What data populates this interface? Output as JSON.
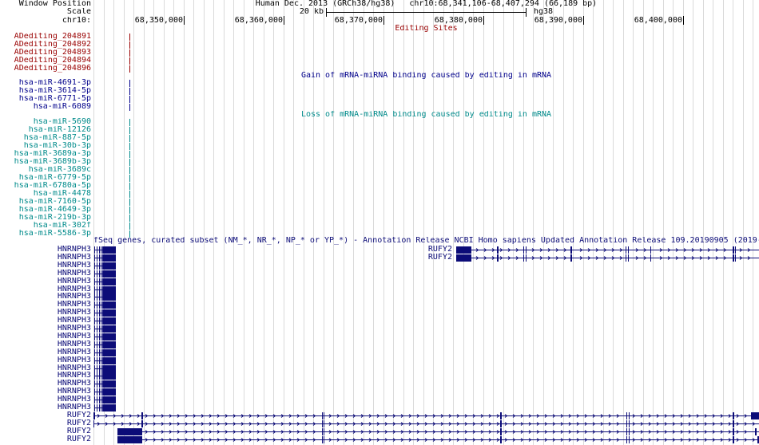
{
  "header": {
    "window_position_label": "Window Position",
    "scale_label": "Scale",
    "chrom_label": "chr10:",
    "assembly": "Human Dec. 2013 (GRCh38/hg38)",
    "position": "chr10:68,341,106-68,407,294 (66,189 bp)",
    "scale_text": "20 kb",
    "db": "hg38",
    "ruler_ticks": [
      "68,350,000",
      "68,360,000",
      "68,370,000",
      "68,380,000",
      "68,390,000",
      "68,400,000"
    ]
  },
  "tracks": {
    "editing_sites": {
      "title": "Editing Sites",
      "color": "#990000",
      "items": [
        "ADediting_204891",
        "ADediting_204892",
        "ADediting_204893",
        "ADediting_204894",
        "ADediting_204896"
      ]
    },
    "gain": {
      "title": "Gain of mRNA-miRNA binding caused by editing in mRNA",
      "color": "#00008b",
      "items": [
        "hsa-miR-4691-3p",
        "hsa-miR-3614-5p",
        "hsa-miR-6771-5p",
        "hsa-miR-6089"
      ]
    },
    "loss": {
      "title": "Loss of mRNA-miRNA binding caused by editing in mRNA",
      "color": "#008b8b",
      "items": [
        "hsa-miR-5690",
        "hsa-miR-12126",
        "hsa-miR-887-5p",
        "hsa-miR-30b-3p",
        "hsa-miR-3689a-3p",
        "hsa-miR-3689b-3p",
        "hsa-miR-3689c",
        "hsa-miR-6779-5p",
        "hsa-miR-6780a-5p",
        "hsa-miR-4478",
        "hsa-miR-7160-5p",
        "hsa-miR-4649-3p",
        "hsa-miR-219b-3p",
        "hsa-miR-302f",
        "hsa-miR-5586-3p"
      ]
    },
    "refseq": {
      "title": "fSeq genes, curated subset (NM_*, NR_*, NP_* or YP_*) - Annotation Release NCBI Homo sapiens Updated Annotation Release 109.20190905 (2019-",
      "color": "#0c0c78",
      "rows": [
        {
          "label": "HNRNPH3",
          "inline_label": "RUFY2"
        },
        {
          "label": "HNRNPH3",
          "inline_label": "RUFY2"
        },
        {
          "label": "HNRNPH3"
        },
        {
          "label": "HNRNPH3"
        },
        {
          "label": "HNRNPH3"
        },
        {
          "label": "HNRNPH3"
        },
        {
          "label": "HNRNPH3"
        },
        {
          "label": "HNRNPH3"
        },
        {
          "label": "HNRNPH3"
        },
        {
          "label": "HNRNPH3"
        },
        {
          "label": "HNRNPH3"
        },
        {
          "label": "HNRNPH3"
        },
        {
          "label": "HNRNPH3"
        },
        {
          "label": "HNRNPH3"
        },
        {
          "label": "HNRNPH3"
        },
        {
          "label": "HNRNPH3"
        },
        {
          "label": "HNRNPH3"
        },
        {
          "label": "HNRNPH3"
        },
        {
          "label": "HNRNPH3"
        },
        {
          "label": "HNRNPH3"
        },
        {
          "label": "HNRNPH3"
        },
        {
          "label": "RUFY2"
        },
        {
          "label": "RUFY2"
        },
        {
          "label": "RUFY2"
        },
        {
          "label": "RUFY2"
        }
      ]
    }
  }
}
